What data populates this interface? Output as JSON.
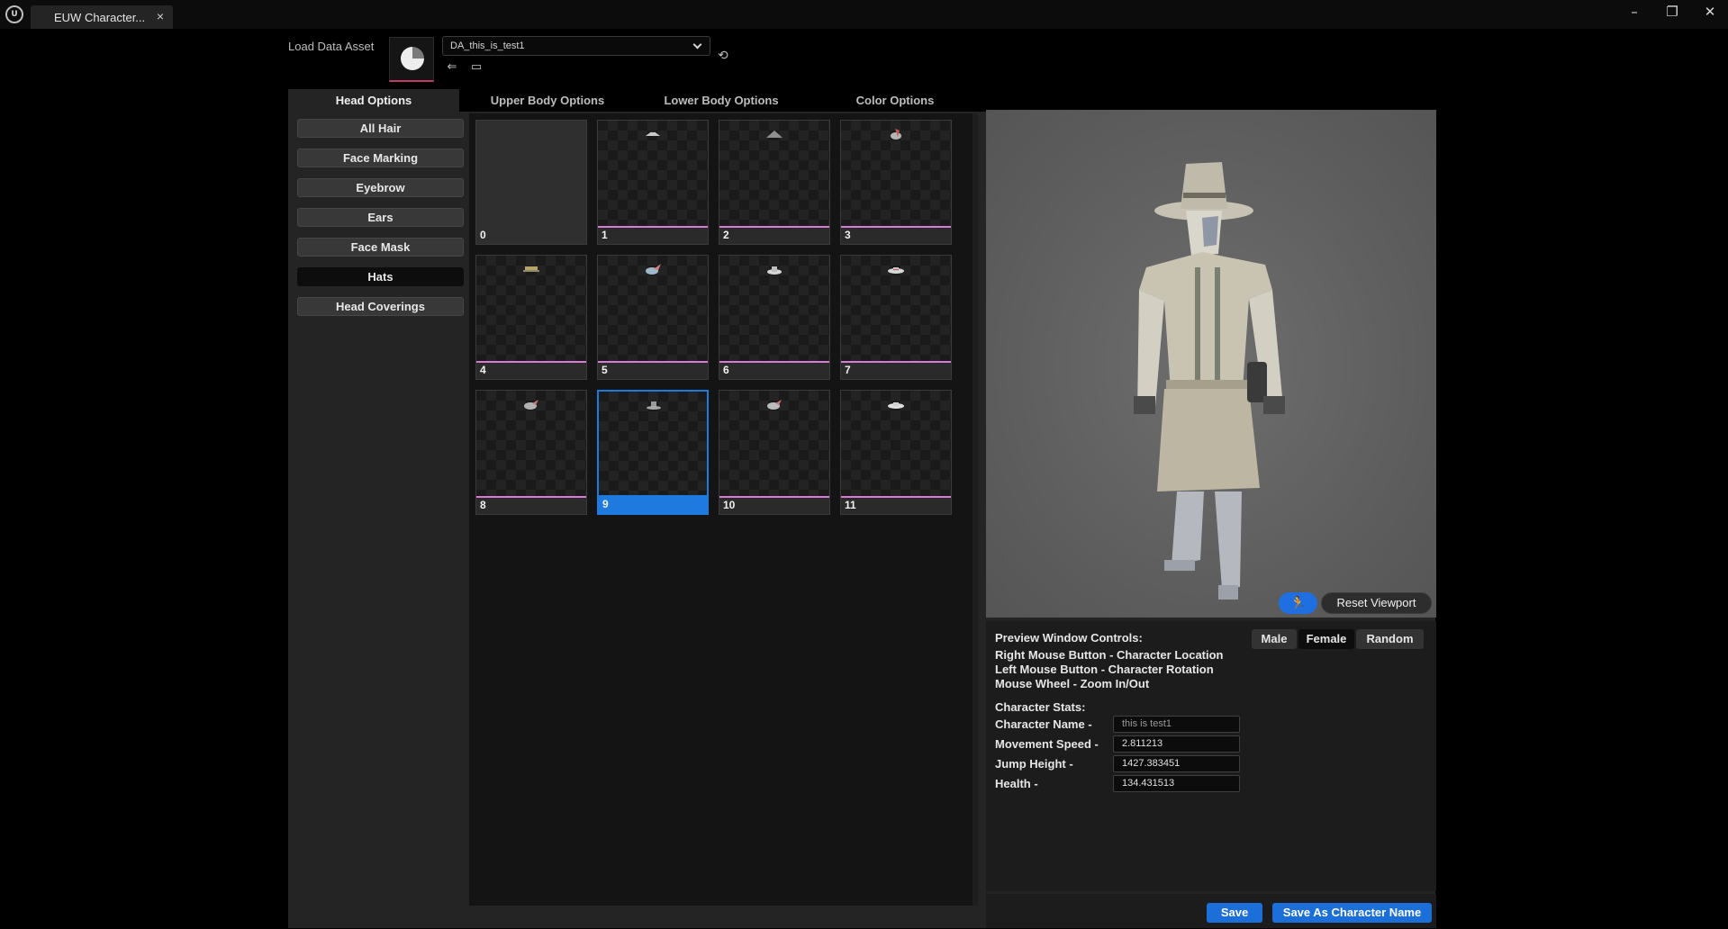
{
  "window": {
    "tab_title": "EUW Character...",
    "close_glyph": "×",
    "minimize_glyph": "–",
    "restore_glyph": "❐",
    "close_window_glyph": "✕",
    "logo_text": "U"
  },
  "asset": {
    "load_label": "Load Data Asset",
    "selected_asset": "DA_this_is_test1"
  },
  "tabs": [
    {
      "label": "Head Options"
    },
    {
      "label": "Upper Body Options"
    },
    {
      "label": "Lower Body Options"
    },
    {
      "label": "Color Options"
    }
  ],
  "sidebar": {
    "items": [
      {
        "label": "All Hair"
      },
      {
        "label": "Face Marking"
      },
      {
        "label": "Eyebrow"
      },
      {
        "label": "Ears"
      },
      {
        "label": "Face Mask"
      },
      {
        "label": "Hats"
      },
      {
        "label": "Head Coverings"
      }
    ],
    "selected": "Hats"
  },
  "grid": {
    "items": [
      {
        "index": "0"
      },
      {
        "index": "1"
      },
      {
        "index": "2"
      },
      {
        "index": "3"
      },
      {
        "index": "4"
      },
      {
        "index": "5"
      },
      {
        "index": "6"
      },
      {
        "index": "7"
      },
      {
        "index": "8"
      },
      {
        "index": "9"
      },
      {
        "index": "10"
      },
      {
        "index": "11"
      }
    ],
    "selected_index": "9",
    "accent_color": "#d77bd6",
    "selected_color": "#1f7ae0"
  },
  "viewport": {
    "reset_label": "Reset Viewport",
    "run_icon": "running-person-icon"
  },
  "controls": {
    "title": "Preview Window Controls:",
    "lines": [
      "Right Mouse Button - Character Location",
      "Left Mouse Button - Character Rotation",
      "Mouse Wheel - Zoom In/Out"
    ],
    "gender_buttons": [
      {
        "label": "Male"
      },
      {
        "label": "Female"
      },
      {
        "label": "Random"
      }
    ],
    "selected_gender": "Female"
  },
  "stats": {
    "title": "Character Stats:",
    "fields": [
      {
        "label": "Character Name -",
        "value": "this is test1"
      },
      {
        "label": "Movement Speed -",
        "value": "2.811213"
      },
      {
        "label": "Jump Height -",
        "value": "1427.383451"
      },
      {
        "label": "Health -",
        "value": "134.431513"
      }
    ]
  },
  "footer": {
    "save_label": "Save",
    "save_as_label": "Save As Character Name"
  }
}
